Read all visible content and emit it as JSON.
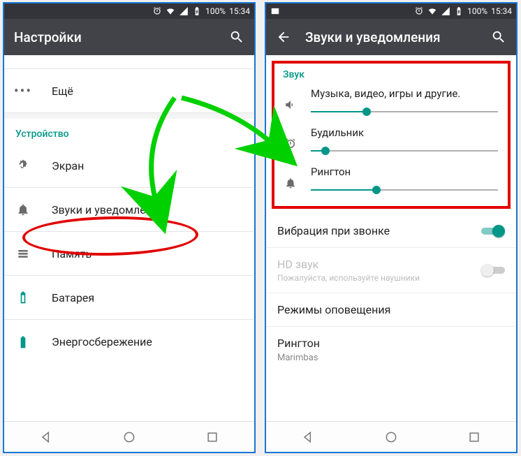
{
  "status": {
    "battery": "100%",
    "time": "15:34"
  },
  "left": {
    "title": "Настройки",
    "more": "Ещё",
    "section_device": "Устройство",
    "items": {
      "screen": "Экран",
      "sounds": "Звуки и уведомления",
      "memory": "Память",
      "battery": "Батарея",
      "power": "Энергосбережение"
    }
  },
  "right": {
    "title": "Звуки и уведомления",
    "section_sound": "Звук",
    "sliders": {
      "media": {
        "label": "Музыка, видео, игры и другие.",
        "value": 30
      },
      "alarm": {
        "label": "Будильник",
        "value": 8
      },
      "ringtone": {
        "label": "Рингтон",
        "value": 35
      }
    },
    "vibrate": {
      "label": "Вибрация при звонке",
      "on": true
    },
    "hd": {
      "label": "HD звук",
      "sub": "Пожалуйста, используйте наушники",
      "on": false
    },
    "modes": "Режимы оповещения",
    "ringtone_row": {
      "title": "Рингтон",
      "value": "Marimbas"
    }
  }
}
